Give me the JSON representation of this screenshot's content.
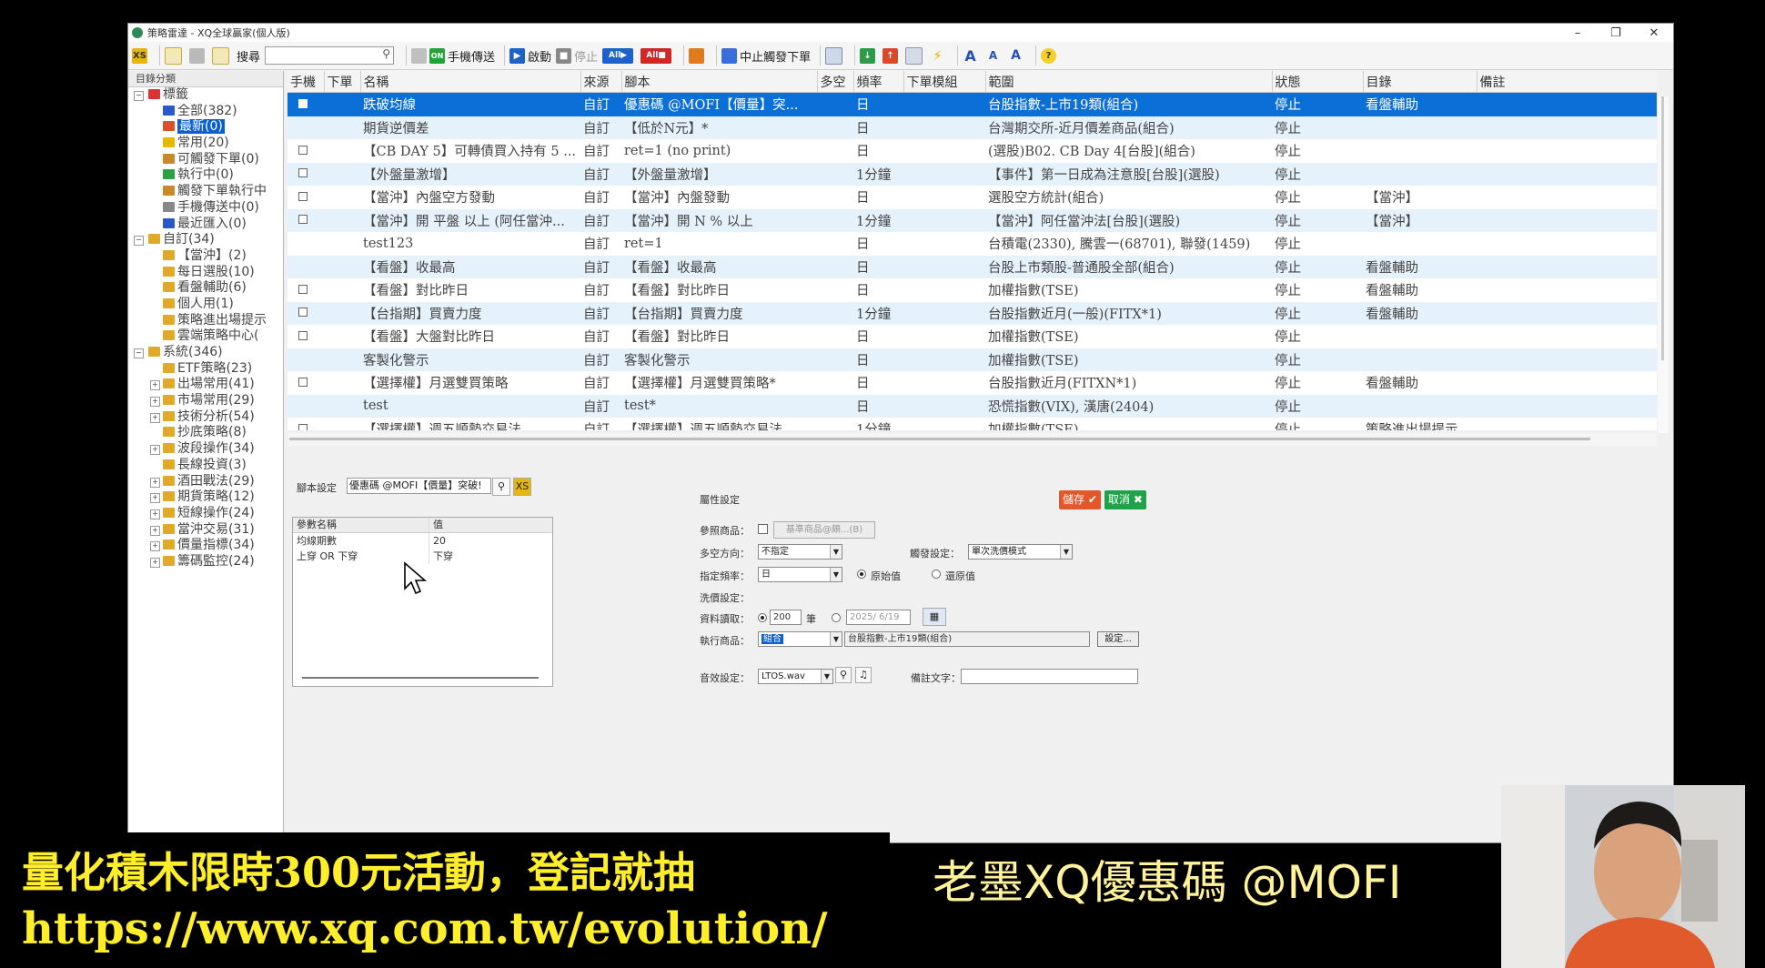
{
  "window": {
    "title": "策略雷達 - XQ全球贏家(個人版)"
  },
  "toolbar": {
    "search_label": "搜尋",
    "search_value": "",
    "send_phone": "手機傳送",
    "start": "啟動",
    "stop": "停止",
    "stop_trigger_order": "中止觸發下單"
  },
  "sidebar": {
    "header": "目錄分類",
    "items": [
      {
        "label": "標籤",
        "level": 0,
        "expand": "−",
        "color": "#d33"
      },
      {
        "label": "全部(382)",
        "level": 1,
        "color": "#2b58c9"
      },
      {
        "label": "最新(0)",
        "level": 1,
        "color": "#d9502a",
        "selected": true
      },
      {
        "label": "常用(20)",
        "level": 1,
        "color": "#e6b800"
      },
      {
        "label": "可觸發下單(0)",
        "level": 1,
        "color": "#c9892a"
      },
      {
        "label": "執行中(0)",
        "level": 1,
        "color": "#2ea043"
      },
      {
        "label": "觸發下單執行中",
        "level": 1,
        "color": "#c9892a"
      },
      {
        "label": "手機傳送中(0)",
        "level": 1,
        "color": "#888"
      },
      {
        "label": "最近匯入(0)",
        "level": 1,
        "color": "#2b58c9"
      },
      {
        "label": "自訂(34)",
        "level": 0,
        "expand": "−",
        "color": "#e0a92a"
      },
      {
        "label": "【當沖】(2)",
        "level": 1,
        "color": "#e0a92a"
      },
      {
        "label": "每日選股(10)",
        "level": 1,
        "color": "#e0a92a"
      },
      {
        "label": "看盤輔助(6)",
        "level": 1,
        "color": "#e0a92a"
      },
      {
        "label": "個人用(1)",
        "level": 1,
        "color": "#e0a92a"
      },
      {
        "label": "策略進出場提示",
        "level": 1,
        "color": "#e0a92a"
      },
      {
        "label": "雲端策略中心(",
        "level": 1,
        "color": "#e0a92a"
      },
      {
        "label": "系統(346)",
        "level": 0,
        "expand": "−",
        "color": "#e0a92a"
      },
      {
        "label": "ETF策略(23)",
        "level": 1,
        "color": "#e0a92a"
      },
      {
        "label": "出場常用(41)",
        "level": 1,
        "expand": "+",
        "color": "#e0a92a"
      },
      {
        "label": "市場常用(29)",
        "level": 1,
        "expand": "+",
        "color": "#e0a92a"
      },
      {
        "label": "技術分析(54)",
        "level": 1,
        "expand": "+",
        "color": "#e0a92a"
      },
      {
        "label": "抄底策略(8)",
        "level": 1,
        "color": "#e0a92a"
      },
      {
        "label": "波段操作(34)",
        "level": 1,
        "expand": "+",
        "color": "#e0a92a"
      },
      {
        "label": "長線投資(3)",
        "level": 1,
        "color": "#e0a92a"
      },
      {
        "label": "酒田戰法(29)",
        "level": 1,
        "expand": "+",
        "color": "#e0a92a"
      },
      {
        "label": "期貨策略(12)",
        "level": 1,
        "expand": "+",
        "color": "#e0a92a"
      },
      {
        "label": "短線操作(24)",
        "level": 1,
        "expand": "+",
        "color": "#e0a92a"
      },
      {
        "label": "當沖交易(31)",
        "level": 1,
        "expand": "+",
        "color": "#e0a92a"
      },
      {
        "label": "價量指標(34)",
        "level": 1,
        "expand": "+",
        "color": "#e0a92a"
      },
      {
        "label": "籌碼監控(24)",
        "level": 1,
        "expand": "+",
        "color": "#e0a92a"
      }
    ]
  },
  "grid": {
    "columns": [
      "手機",
      "下單",
      "名稱",
      "來源",
      "腳本",
      "多空",
      "頻率",
      "下單模組",
      "範圍",
      "狀態",
      "目錄",
      "備註"
    ],
    "rows": [
      {
        "phone": true,
        "name": "跌破均線",
        "src": "自訂",
        "script": "優惠碼 @MOFI【價量】突...",
        "freq": "日",
        "range": "台股指數-上市19類(組合)",
        "status": "停止",
        "dir": "看盤輔助",
        "sel": true
      },
      {
        "phone": false,
        "name": "期貨逆價差",
        "src": "自訂",
        "script": "【低於N元】*",
        "freq": "日",
        "range": "台灣期交所-近月價差商品(組合)",
        "status": "停止",
        "dir": ""
      },
      {
        "phone": true,
        "name": "【CB DAY 5】可轉債買入持有 5 ...",
        "src": "自訂",
        "script": "ret=1 (no print)",
        "freq": "日",
        "range": "(選股)B02. CB Day 4[台股](組合)",
        "status": "停止",
        "dir": ""
      },
      {
        "phone": true,
        "name": "【外盤量激增】",
        "src": "自訂",
        "script": "【外盤量激增】",
        "freq": "1分鐘",
        "range": "【事件】第一日成為注意股[台股](選股)",
        "status": "停止",
        "dir": ""
      },
      {
        "phone": true,
        "name": "【當沖】內盤空方發動",
        "src": "自訂",
        "script": "【當沖】內盤發動",
        "freq": "日",
        "range": "選股空方統計(組合)",
        "status": "停止",
        "dir": "【當沖】"
      },
      {
        "phone": true,
        "name": "【當沖】開 平盤 以上 (阿任當沖...",
        "src": "自訂",
        "script": "【當沖】開 N % 以上",
        "freq": "1分鐘",
        "range": "【當沖】阿任當沖法[台股](選股)",
        "status": "停止",
        "dir": "【當沖】"
      },
      {
        "phone": false,
        "name": "test123",
        "src": "自訂",
        "script": "ret=1",
        "freq": "日",
        "range": "台積電(2330), 騰雲一(68701), 聯發(1459)",
        "status": "停止",
        "dir": ""
      },
      {
        "phone": false,
        "name": "【看盤】收最高",
        "src": "自訂",
        "script": "【看盤】收最高",
        "freq": "日",
        "range": "台股上市類股-普通股全部(組合)",
        "status": "停止",
        "dir": "看盤輔助"
      },
      {
        "phone": true,
        "name": "【看盤】對比昨日",
        "src": "自訂",
        "script": "【看盤】對比昨日",
        "freq": "日",
        "range": "加權指數(TSE)",
        "status": "停止",
        "dir": "看盤輔助"
      },
      {
        "phone": true,
        "name": "【台指期】買賣力度",
        "src": "自訂",
        "script": "【台指期】買賣力度",
        "freq": "1分鐘",
        "range": "台股指數近月(一般)(FITX*1)",
        "status": "停止",
        "dir": "看盤輔助"
      },
      {
        "phone": true,
        "name": "【看盤】大盤對比昨日",
        "src": "自訂",
        "script": "【看盤】對比昨日",
        "freq": "日",
        "range": "加權指數(TSE)",
        "status": "停止",
        "dir": ""
      },
      {
        "phone": false,
        "name": "客製化警示",
        "src": "自訂",
        "script": "客製化警示",
        "freq": "日",
        "range": "加權指數(TSE)",
        "status": "停止",
        "dir": ""
      },
      {
        "phone": true,
        "name": "【選擇權】月選雙買策略",
        "src": "自訂",
        "script": "【選擇權】月選雙買策略*",
        "freq": "日",
        "range": "台股指數近月(FITXN*1)",
        "status": "停止",
        "dir": "看盤輔助"
      },
      {
        "phone": false,
        "name": "test",
        "src": "自訂",
        "script": "test*",
        "freq": "日",
        "range": "恐慌指數(VIX), 漢唐(2404)",
        "status": "停止",
        "dir": ""
      },
      {
        "phone": true,
        "name": "【選擇權】週五順勢交易法",
        "src": "自訂",
        "script": "【選擇權】週五順勢交易法",
        "freq": "1分鐘",
        "range": "加權指數(TSE)",
        "status": "停止",
        "dir": "策略進出場提示"
      }
    ]
  },
  "script_settings": {
    "label": "腳本設定",
    "value": "優惠碼 @MOFI【價量】突破!",
    "param_header_name": "參數名稱",
    "param_header_value": "值",
    "params": [
      {
        "name": "均線期數",
        "value": "20"
      },
      {
        "name": "上穿 OR 下穿",
        "value": "下穿"
      }
    ]
  },
  "properties": {
    "title": "屬性設定",
    "save": "儲存",
    "cancel": "取消",
    "ref_label": "參照商品：",
    "ref_btn": "基準商品@頗...(B)",
    "direction_label": "多空方向：",
    "direction_value": "不指定",
    "trigger_label": "觸發設定：",
    "trigger_value": "單次洗價模式",
    "freq_label": "指定頻率：",
    "freq_value": "日",
    "orig_value": "原始值",
    "restored_value": "還原值",
    "wash_label": "洗價設定：",
    "data_label": "資料讀取：",
    "data_count": "200",
    "data_unit": "筆",
    "data_date": "2025/ 6/19",
    "exec_label": "執行商品：",
    "exec_value": "組合",
    "exec_text": "台股指數-上市19類(組合)",
    "setup_btn": "設定...",
    "sound_label": "音效設定：",
    "sound_value": "LTOS.wav",
    "note_label": "備註文字：",
    "note_value": ""
  },
  "banner": {
    "line1": "量化積木限時300元活動，登記就抽",
    "line2": "https://www.xq.com.tw/evolution/",
    "right": "老墨XQ優惠碼 @MOFI"
  }
}
